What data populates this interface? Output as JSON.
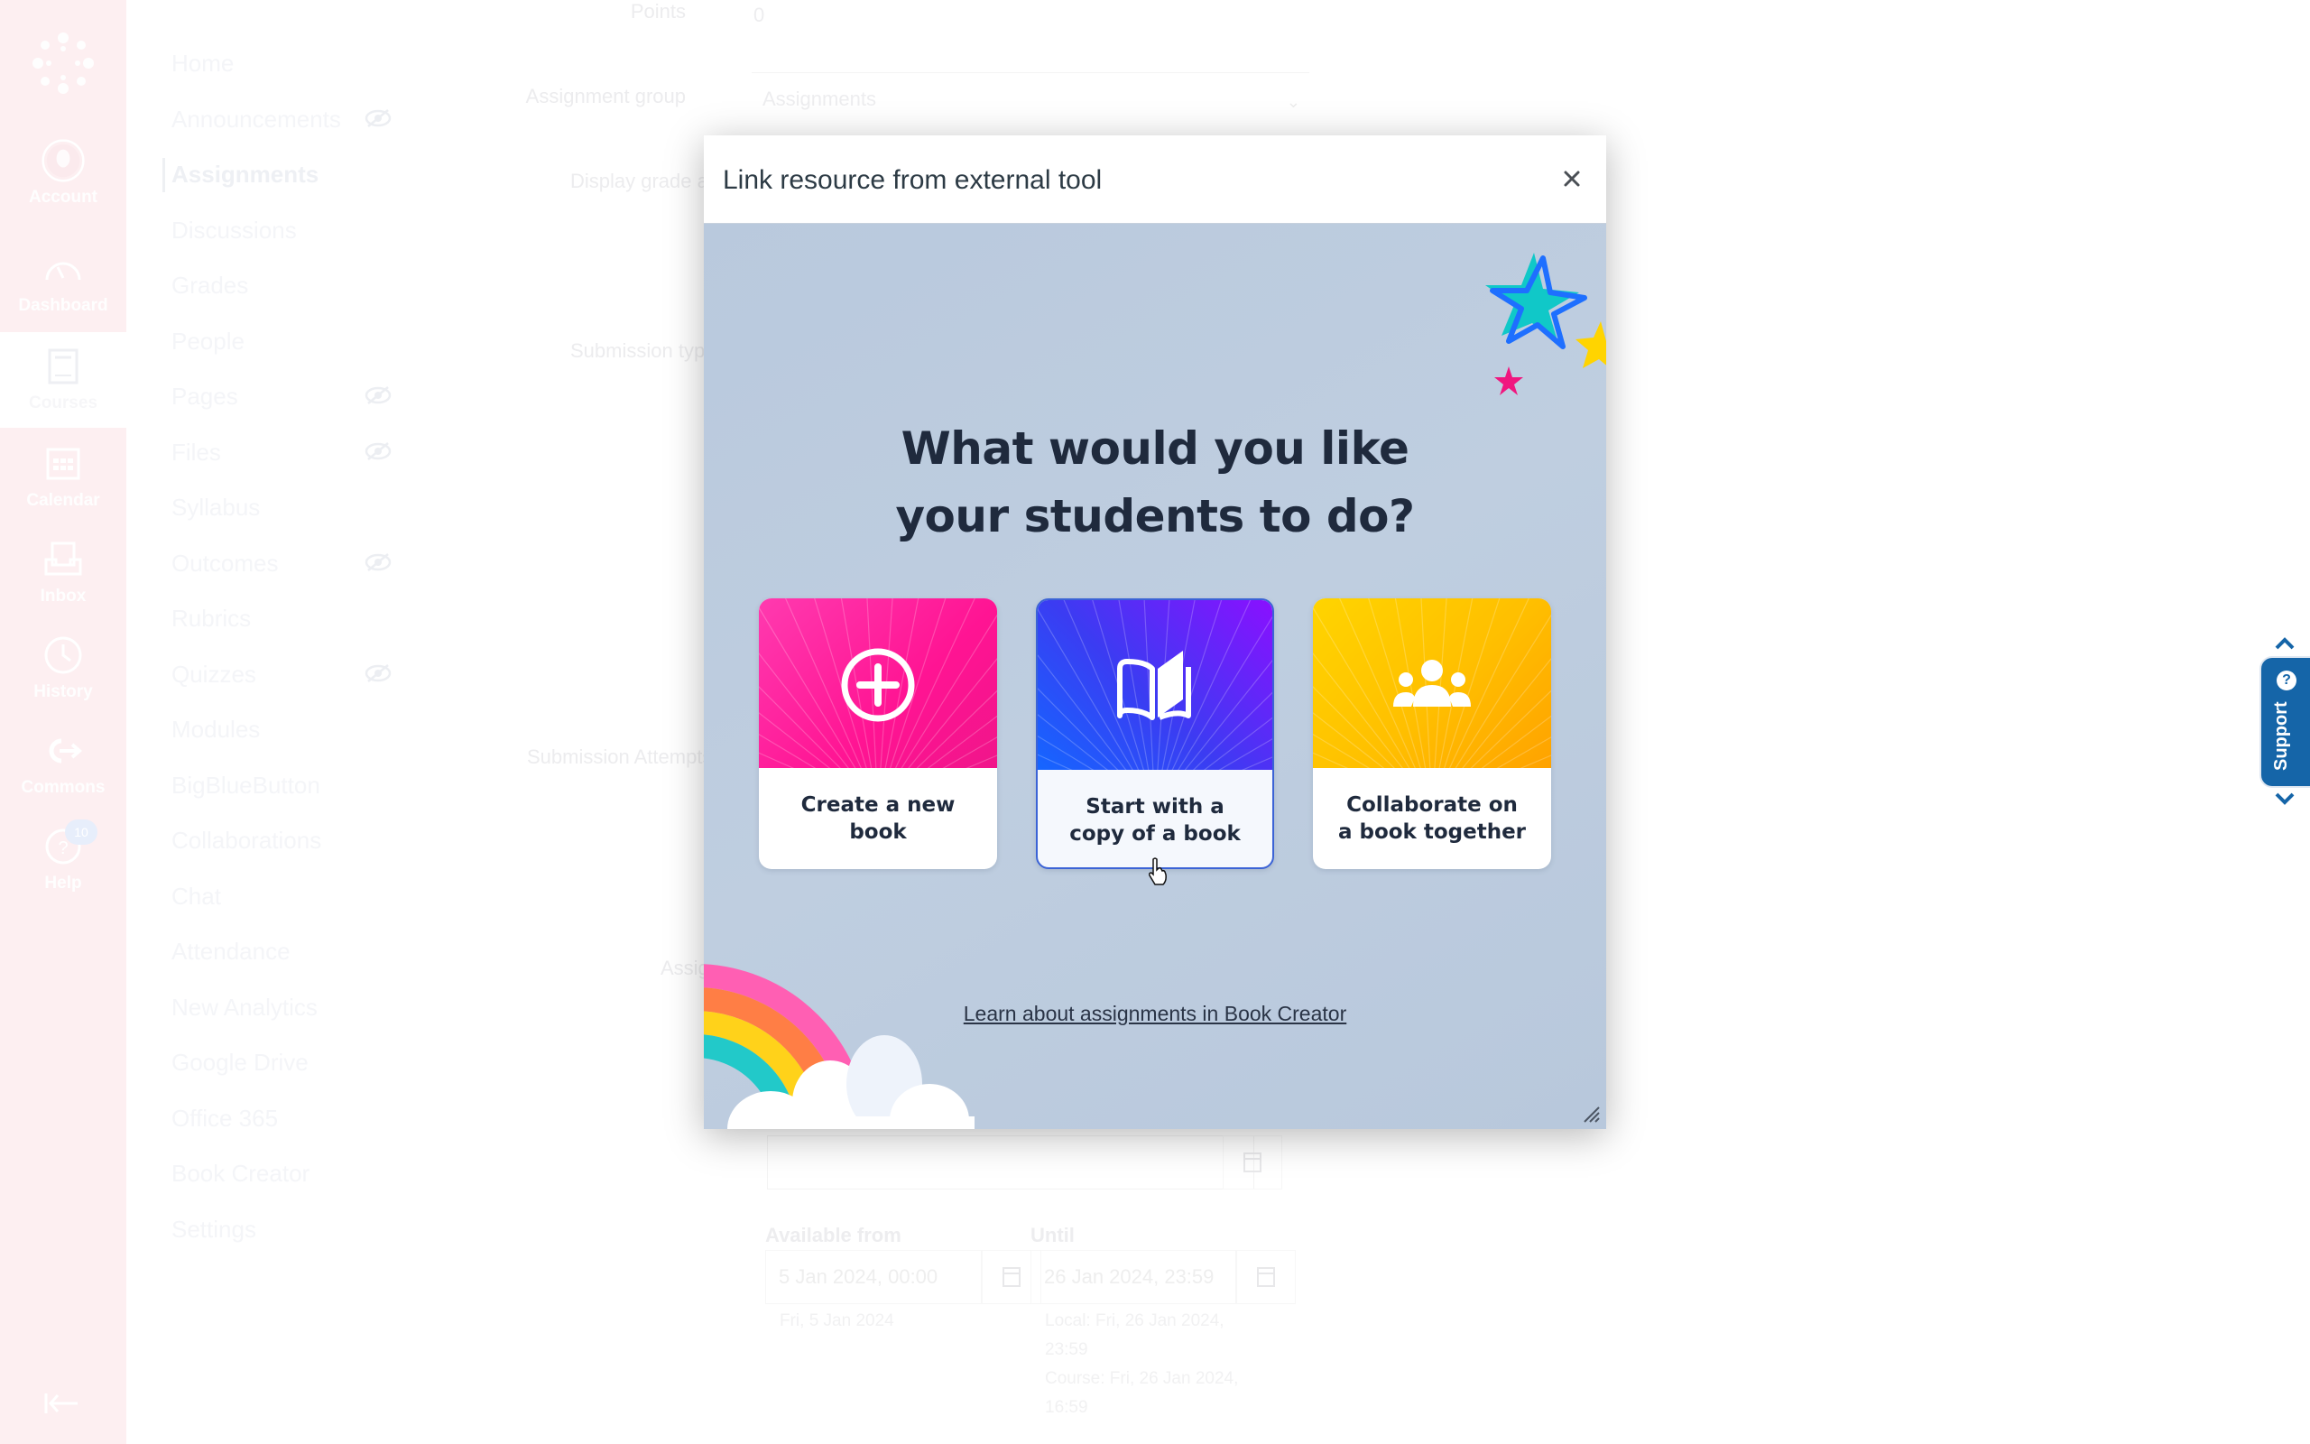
{
  "global_nav": {
    "logo_icon": "canvas-logo-icon",
    "items": [
      {
        "label": "Account",
        "icon": "avatar-icon"
      },
      {
        "label": "Dashboard",
        "icon": "dashboard-icon"
      },
      {
        "label": "Courses",
        "icon": "courses-icon",
        "active": true
      },
      {
        "label": "Calendar",
        "icon": "calendar-icon"
      },
      {
        "label": "Inbox",
        "icon": "inbox-icon"
      },
      {
        "label": "History",
        "icon": "clock-icon"
      },
      {
        "label": "Commons",
        "icon": "commons-icon"
      },
      {
        "label": "Help",
        "icon": "help-icon",
        "badge": "10"
      }
    ],
    "collapse_icon": "collapse-nav-icon"
  },
  "course_nav": {
    "items": [
      {
        "label": "Home"
      },
      {
        "label": "Announcements",
        "hidden_icon": true
      },
      {
        "label": "Assignments",
        "active": true
      },
      {
        "label": "Discussions"
      },
      {
        "label": "Grades"
      },
      {
        "label": "People"
      },
      {
        "label": "Pages",
        "hidden_icon": true
      },
      {
        "label": "Files",
        "hidden_icon": true
      },
      {
        "label": "Syllabus"
      },
      {
        "label": "Outcomes",
        "hidden_icon": true
      },
      {
        "label": "Rubrics"
      },
      {
        "label": "Quizzes",
        "hidden_icon": true
      },
      {
        "label": "Modules"
      },
      {
        "label": "BigBlueButton"
      },
      {
        "label": "Collaborations"
      },
      {
        "label": "Chat"
      },
      {
        "label": "Attendance"
      },
      {
        "label": "New Analytics"
      },
      {
        "label": "Google Drive"
      },
      {
        "label": "Office 365"
      },
      {
        "label": "Book Creator"
      },
      {
        "label": "Settings"
      }
    ]
  },
  "form": {
    "points_label": "Points",
    "points_value": "0",
    "assignment_group_label": "Assignment group",
    "assignment_group_value": "Assignments",
    "display_grade_label": "Display grade as",
    "submission_type_label": "Submission type",
    "submission_attempts_label": "Submission Attempts",
    "assign_label": "Assign",
    "available_from_label": "Available from",
    "available_from_value": "5 Jan 2024, 00:00",
    "available_from_note": "Fri, 5 Jan 2024",
    "until_label": "Until",
    "until_value": "26 Jan 2024, 23:59",
    "until_note_local": "Local: Fri, 26 Jan 2024, 23:59",
    "until_note_course": "Course: Fri, 26 Jan 2024, 16:59"
  },
  "modal": {
    "title": "Link resource from external tool",
    "close_icon": "close-icon",
    "heading_line1": "What would you like",
    "heading_line2": "your students to do?",
    "cards": [
      {
        "label": "Create a new book",
        "icon": "plus-circle-icon",
        "color_from": "#ff3aaf",
        "color_to": "#f0158a"
      },
      {
        "label": "Start with a copy of a book",
        "icon": "open-book-icon",
        "color_from": "#1566ff",
        "color_to": "#8a10ff",
        "hovered": true
      },
      {
        "label": "Collaborate on a book together",
        "icon": "group-icon",
        "color_from": "#ffd400",
        "color_to": "#ffa200"
      }
    ],
    "learn_link": "Learn about assignments in Book Creator",
    "background_color": "#bccbde"
  },
  "support": {
    "label": "Support",
    "icon": "question-icon",
    "color": "#1565a8"
  }
}
